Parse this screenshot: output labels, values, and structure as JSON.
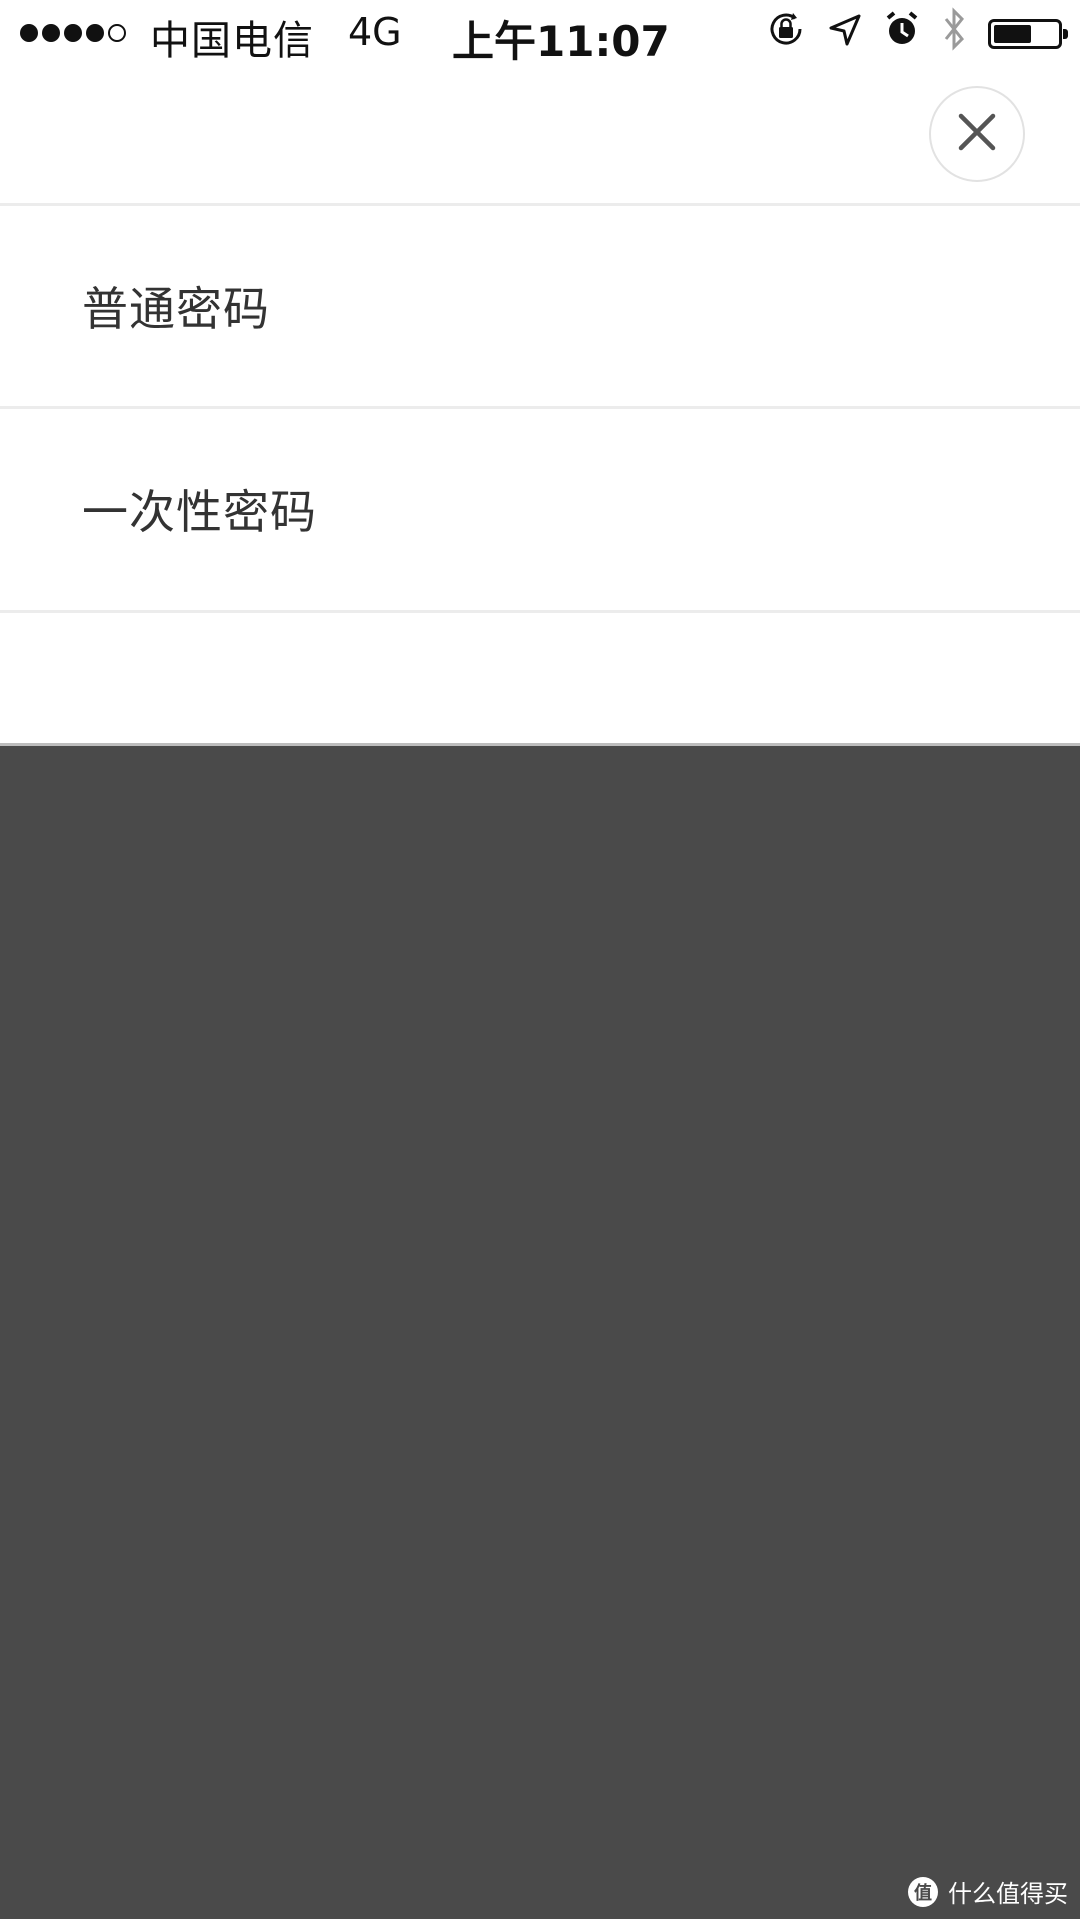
{
  "status_bar": {
    "carrier": "中国电信",
    "network": "4G",
    "time": "上午11:07",
    "signal_bars_filled": 4,
    "signal_bars_total": 5,
    "battery_level": 0.6
  },
  "sheet": {
    "close_icon": "close-icon",
    "options": [
      {
        "label": "普通密码"
      },
      {
        "label": "一次性密码"
      }
    ]
  },
  "colors": {
    "overlay": "#4a4a4a",
    "sheet_bg": "#ffffff",
    "text": "#333333",
    "divider": "#ececec"
  },
  "watermark": {
    "text": "什么值得买",
    "logo_glyph": "值"
  }
}
